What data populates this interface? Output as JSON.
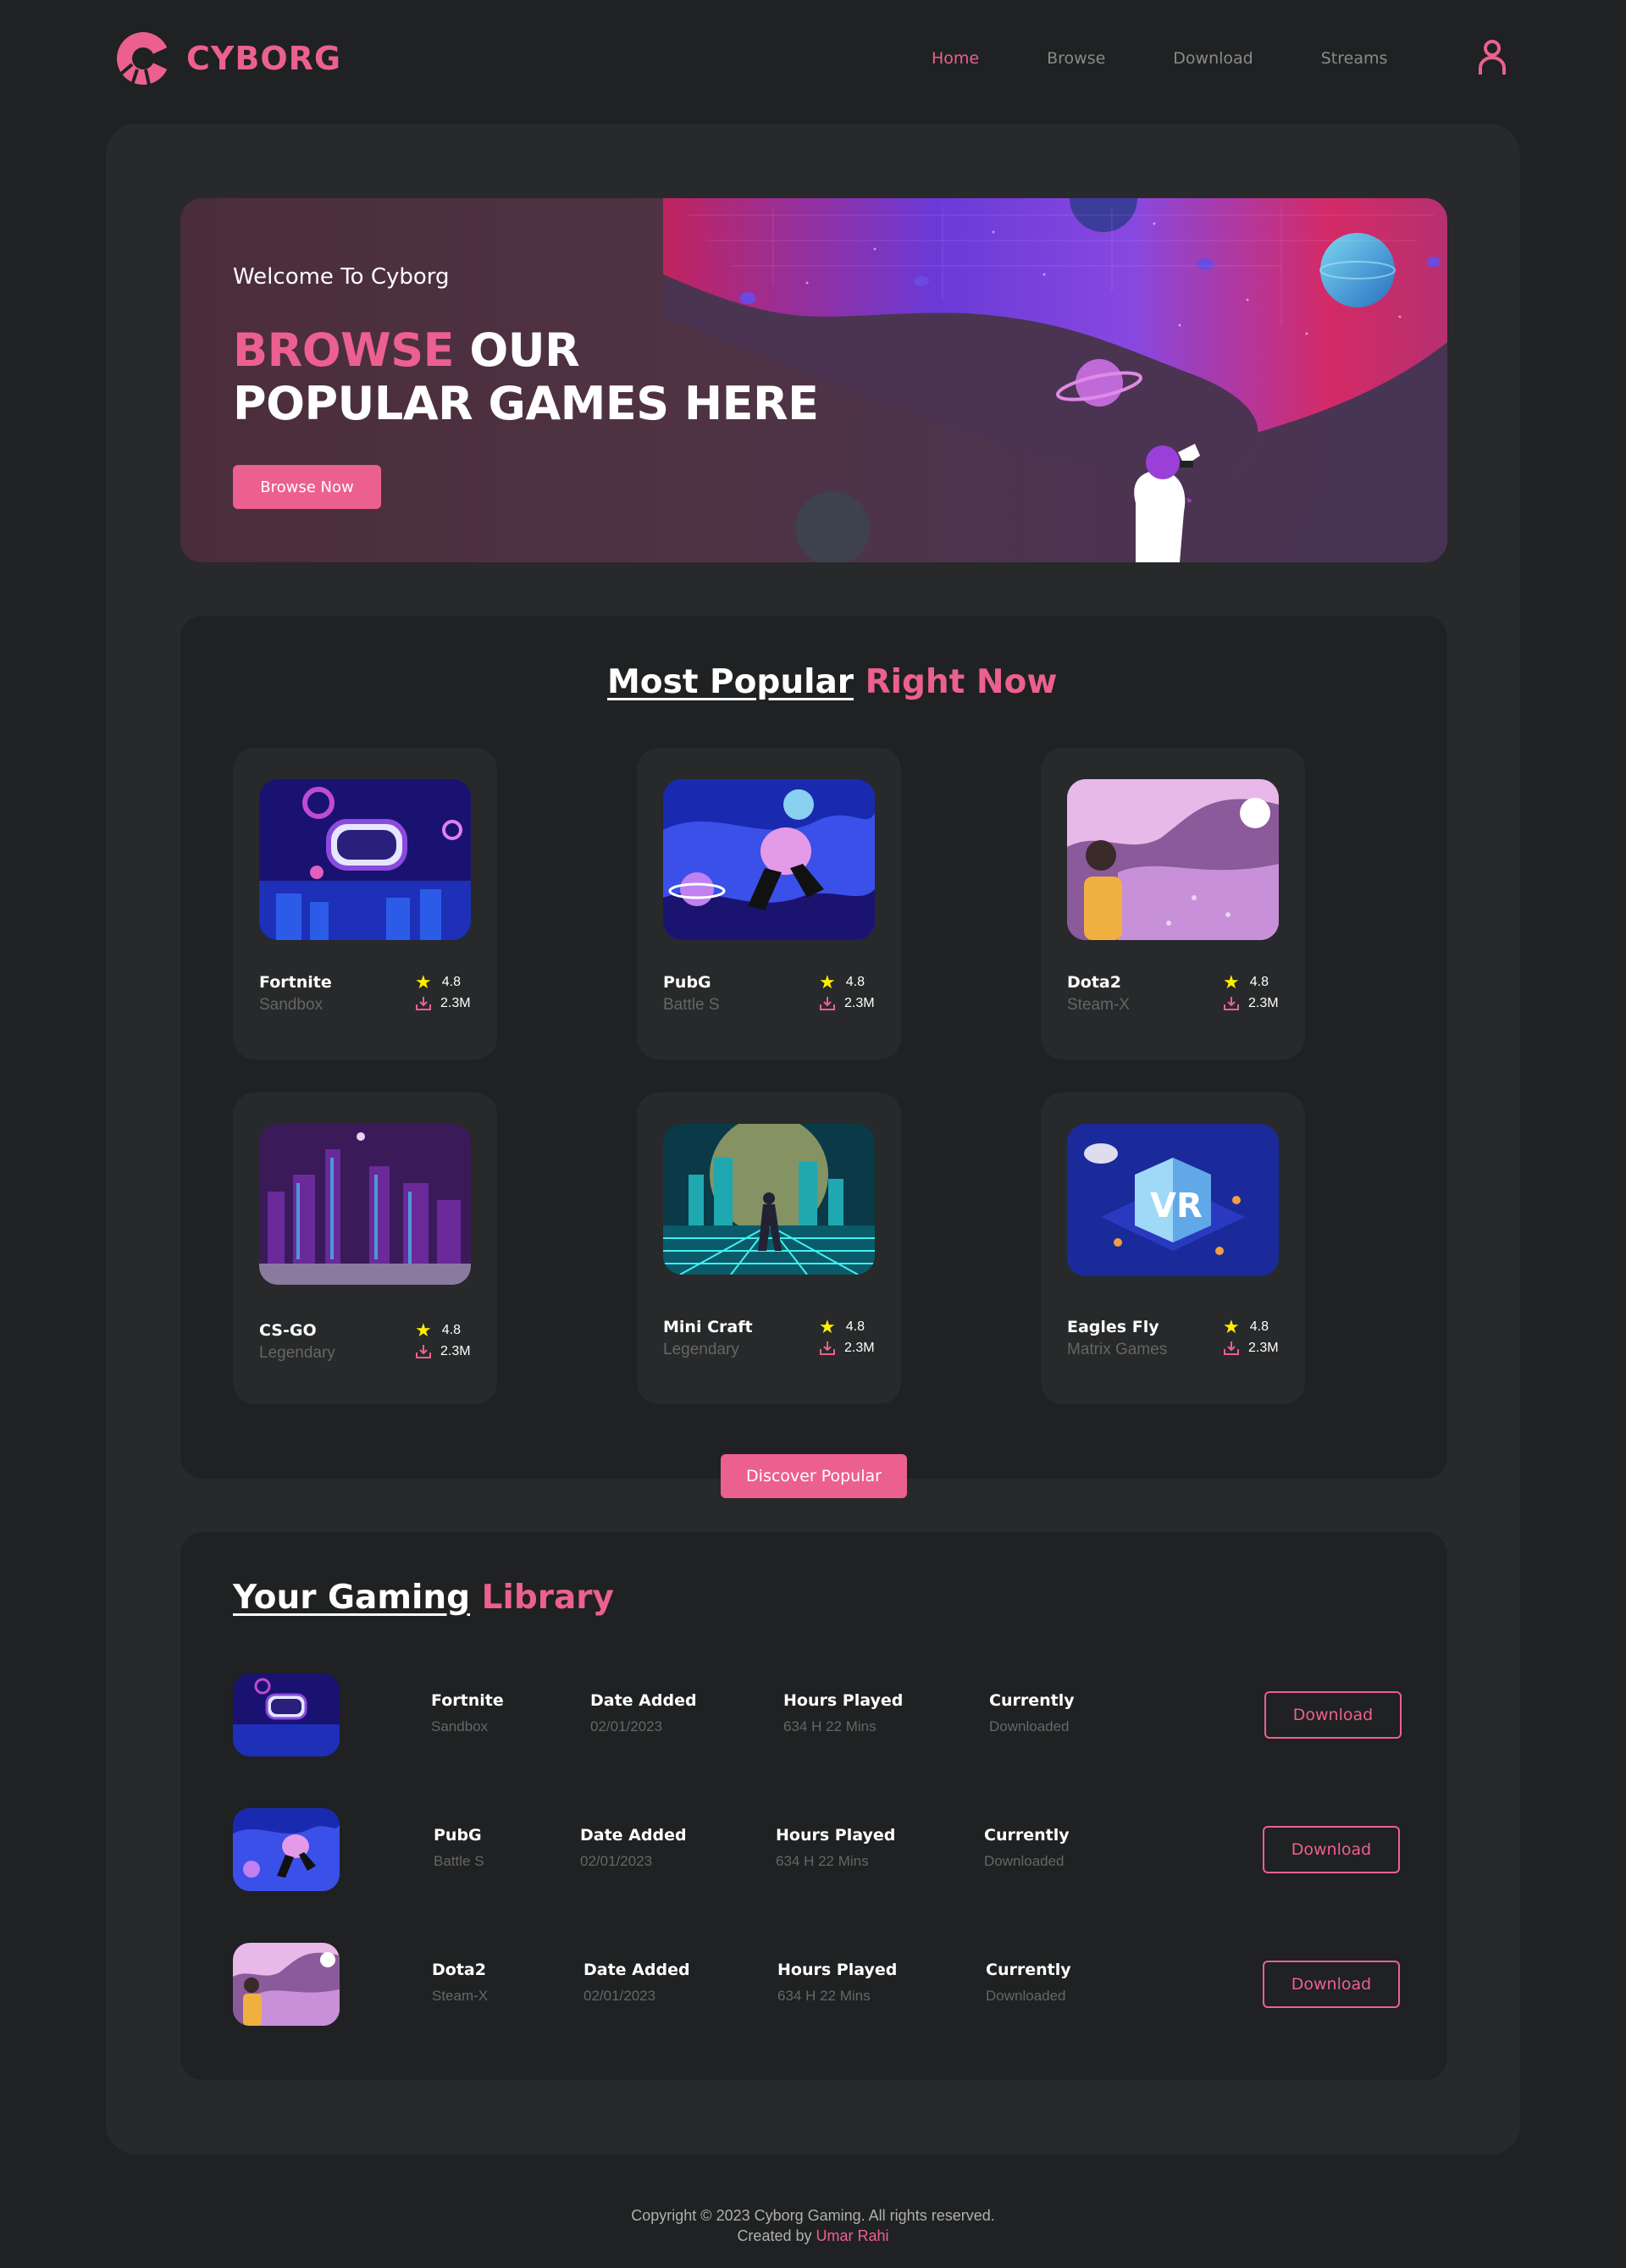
{
  "header": {
    "logo_text": "CYBORG",
    "nav": [
      "Home",
      "Browse",
      "Download",
      "Streams"
    ],
    "active_nav": "Home"
  },
  "banner": {
    "welcome": "Welcome To Cyborg",
    "title_highlight": "BROWSE",
    "title_rest_line1": "OUR",
    "title_line2": "POPULAR GAMES HERE",
    "button": "Browse Now"
  },
  "popular": {
    "heading_main": "Most Popular",
    "heading_highlight": "Right Now",
    "games": [
      {
        "name": "Fortnite",
        "category": "Sandbox",
        "rating": "4.8",
        "downloads": "2.3M",
        "art": "vr-headset"
      },
      {
        "name": "PubG",
        "category": "Battle S",
        "rating": "4.8",
        "downloads": "2.3M",
        "art": "floating-gamer"
      },
      {
        "name": "Dota2",
        "category": "Steam-X",
        "rating": "4.8",
        "downloads": "2.3M",
        "art": "vr-girl-astronaut"
      },
      {
        "name": "CS-GO",
        "category": "Legendary",
        "rating": "4.8",
        "downloads": "2.3M",
        "art": "neon-city"
      },
      {
        "name": "Mini Craft",
        "category": "Legendary",
        "rating": "4.8",
        "downloads": "2.3M",
        "art": "cyber-grid-runner"
      },
      {
        "name": "Eagles Fly",
        "category": "Matrix Games",
        "rating": "4.8",
        "downloads": "2.3M",
        "art": "isometric-vr"
      }
    ],
    "button": "Discover Popular"
  },
  "library": {
    "heading_main": "Your Gaming",
    "heading_highlight": "Library",
    "rows": [
      {
        "name": "Fortnite",
        "category": "Sandbox",
        "date_label": "Date Added",
        "date": "02/01/2023",
        "hours_label": "Hours Played",
        "hours": "634 H 22 Mins",
        "status_label": "Currently",
        "status": "Downloaded",
        "button": "Download"
      },
      {
        "name": "PubG",
        "category": "Battle S",
        "date_label": "Date Added",
        "date": "02/01/2023",
        "hours_label": "Hours Played",
        "hours": "634 H 22 Mins",
        "status_label": "Currently",
        "status": "Downloaded",
        "button": "Download"
      },
      {
        "name": "Dota2",
        "category": "Steam-X",
        "date_label": "Date Added",
        "date": "02/01/2023",
        "hours_label": "Hours Played",
        "hours": "634 H 22 Mins",
        "status_label": "Currently",
        "status": "Downloaded",
        "button": "Download"
      }
    ]
  },
  "footer": {
    "copyright": "Copyright © 2023 Cyborg Gaming. All rights reserved.",
    "created_by": "Created by",
    "author": "Umar Rahi"
  },
  "colors": {
    "accent": "#ec6090",
    "background": "#1f2122",
    "panel": "#27292a",
    "star": "#ffee00"
  }
}
